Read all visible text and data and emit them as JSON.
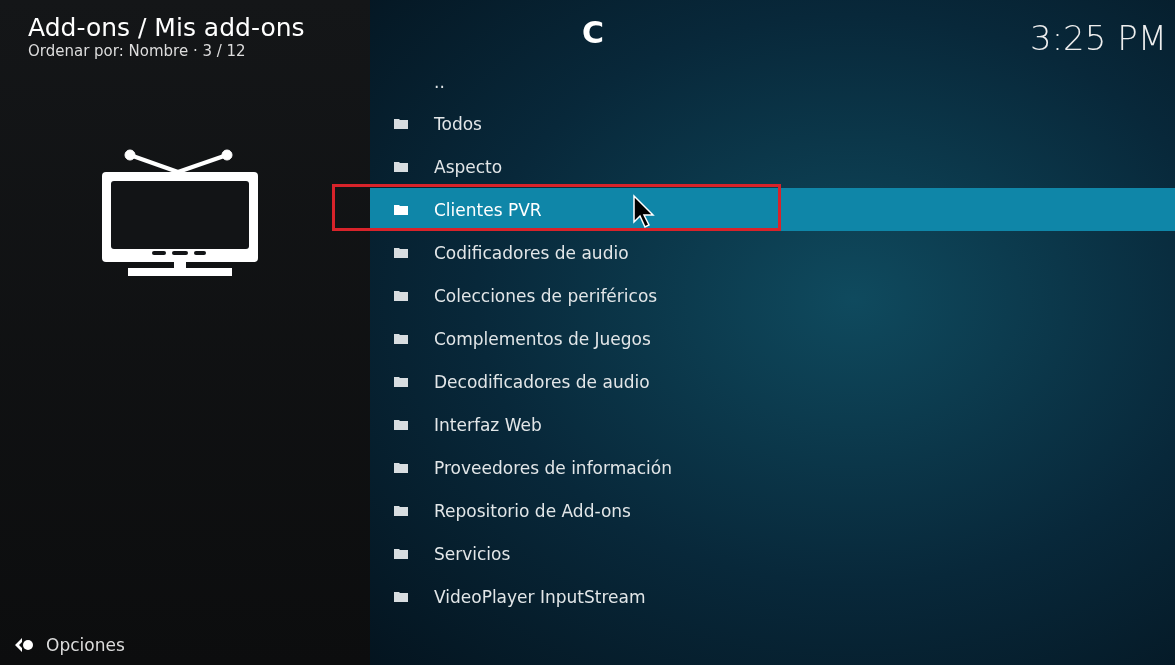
{
  "header": {
    "title": "Add-ons / Mis add-ons",
    "subtitle": "Ordenar por: Nombre · 3 / 12",
    "letter": "C",
    "clock": "3:25 PM"
  },
  "options_label": "Opciones",
  "items": [
    {
      "label": "..",
      "kind": "parent",
      "selected": false
    },
    {
      "label": "Todos",
      "kind": "folder",
      "selected": false
    },
    {
      "label": "Aspecto",
      "kind": "folder",
      "selected": false
    },
    {
      "label": "Clientes PVR",
      "kind": "folder",
      "selected": true
    },
    {
      "label": "Codificadores de audio",
      "kind": "folder",
      "selected": false
    },
    {
      "label": "Colecciones de periféricos",
      "kind": "folder",
      "selected": false
    },
    {
      "label": "Complementos de Juegos",
      "kind": "folder",
      "selected": false
    },
    {
      "label": "Decodificadores de audio",
      "kind": "folder",
      "selected": false
    },
    {
      "label": "Interfaz Web",
      "kind": "folder",
      "selected": false
    },
    {
      "label": "Proveedores de información",
      "kind": "folder",
      "selected": false
    },
    {
      "label": "Repositorio de Add-ons",
      "kind": "folder",
      "selected": false
    },
    {
      "label": "Servicios",
      "kind": "folder",
      "selected": false
    },
    {
      "label": "VideoPlayer InputStream",
      "kind": "folder",
      "selected": false
    }
  ]
}
